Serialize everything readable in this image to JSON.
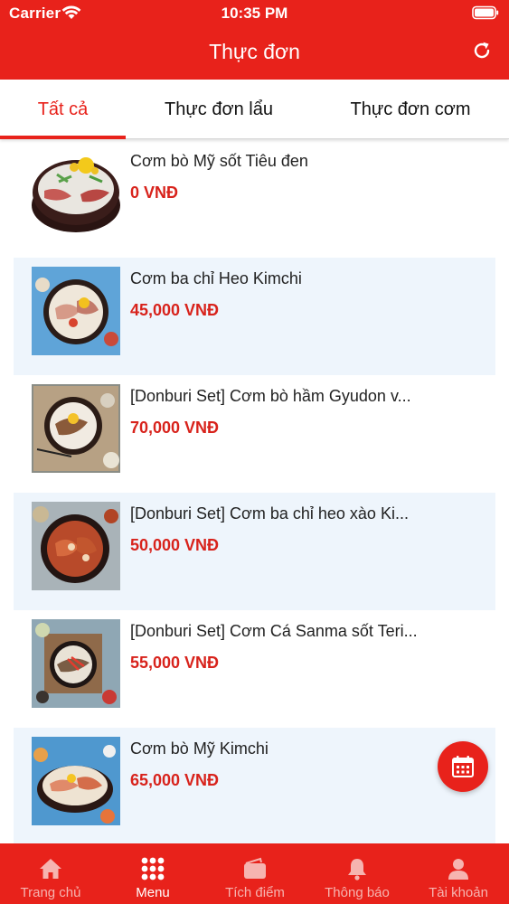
{
  "status_bar": {
    "carrier": "Carrier",
    "time": "10:35 PM"
  },
  "header": {
    "title": "Thực đơn",
    "refresh_icon": "refresh-icon"
  },
  "tabs": [
    {
      "label": "Tất cả",
      "active": true
    },
    {
      "label": "Thực đơn lẩu",
      "active": false
    },
    {
      "label": "Thực đơn cơm",
      "active": false
    }
  ],
  "menu_items": [
    {
      "name": "Cơm bò Mỹ sốt Tiêu đen",
      "price": "0 VNĐ"
    },
    {
      "name": "Cơm ba chỉ Heo Kimchi",
      "price": "45,000 VNĐ"
    },
    {
      "name": "[Donburi Set] Cơm bò hầm Gyudon v...",
      "price": "70,000 VNĐ"
    },
    {
      "name": "[Donburi Set] Cơm ba chỉ heo xào Ki...",
      "price": "50,000 VNĐ"
    },
    {
      "name": "[Donburi Set] Cơm Cá Sanma sốt Teri...",
      "price": "55,000 VNĐ"
    },
    {
      "name": "Cơm bò Mỹ Kimchi",
      "price": "65,000 VNĐ"
    }
  ],
  "fab": {
    "icon": "calendar-icon"
  },
  "tabbar": [
    {
      "label": "Trang chủ",
      "icon": "home-icon",
      "active": false
    },
    {
      "label": "Menu",
      "icon": "grid-icon",
      "active": true
    },
    {
      "label": "Tích điểm",
      "icon": "wallet-icon",
      "active": false
    },
    {
      "label": "Thông báo",
      "icon": "bell-icon",
      "active": false
    },
    {
      "label": "Tài khoản",
      "icon": "user-icon",
      "active": false
    }
  ],
  "colors": {
    "brand": "#e8221b",
    "price": "#d8231c",
    "alt_row": "#eef5fc"
  }
}
